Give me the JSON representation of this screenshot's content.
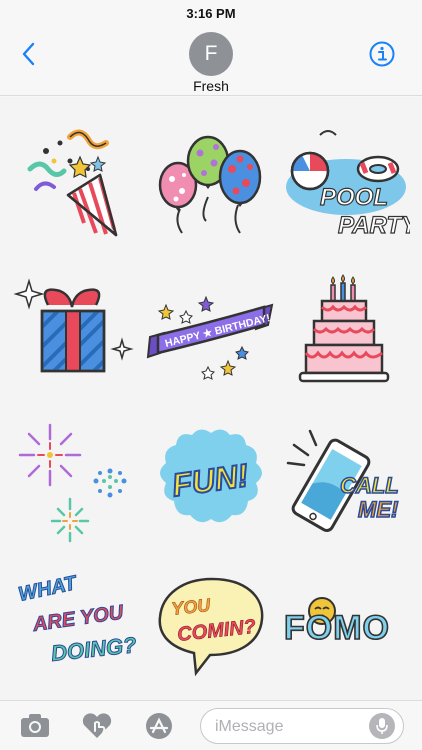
{
  "status_bar": {
    "time": "3:16 PM"
  },
  "header": {
    "contact_initial": "F",
    "contact_name": "Fresh",
    "accent_color": "#1a82f7"
  },
  "stickers": [
    {
      "name": "party-popper"
    },
    {
      "name": "balloons"
    },
    {
      "name": "pool-party",
      "text_line1": "POOL",
      "text_line2": "PARTY"
    },
    {
      "name": "gift-box"
    },
    {
      "name": "happy-birthday-banner",
      "text": "HAPPY ★ BIRTHDAY!"
    },
    {
      "name": "birthday-cake"
    },
    {
      "name": "fireworks"
    },
    {
      "name": "fun",
      "text": "FUN!"
    },
    {
      "name": "call-me-phone",
      "text_line1": "CALL",
      "text_line2": "ME!"
    },
    {
      "name": "what-are-you-doing",
      "text_line1": "WHAT",
      "text_line2": "ARE YOU",
      "text_line3": "DOING?"
    },
    {
      "name": "you-comin",
      "text_line1": "YOU",
      "text_line2": "COMIN?"
    },
    {
      "name": "fomo",
      "text": "FOMO"
    }
  ],
  "input": {
    "placeholder": "iMessage"
  },
  "toolbar": {
    "camera_icon": "camera-icon",
    "digital_touch_icon": "heart-touch-icon",
    "app_store_icon": "app-store-icon",
    "mic_icon": "microphone-icon"
  }
}
